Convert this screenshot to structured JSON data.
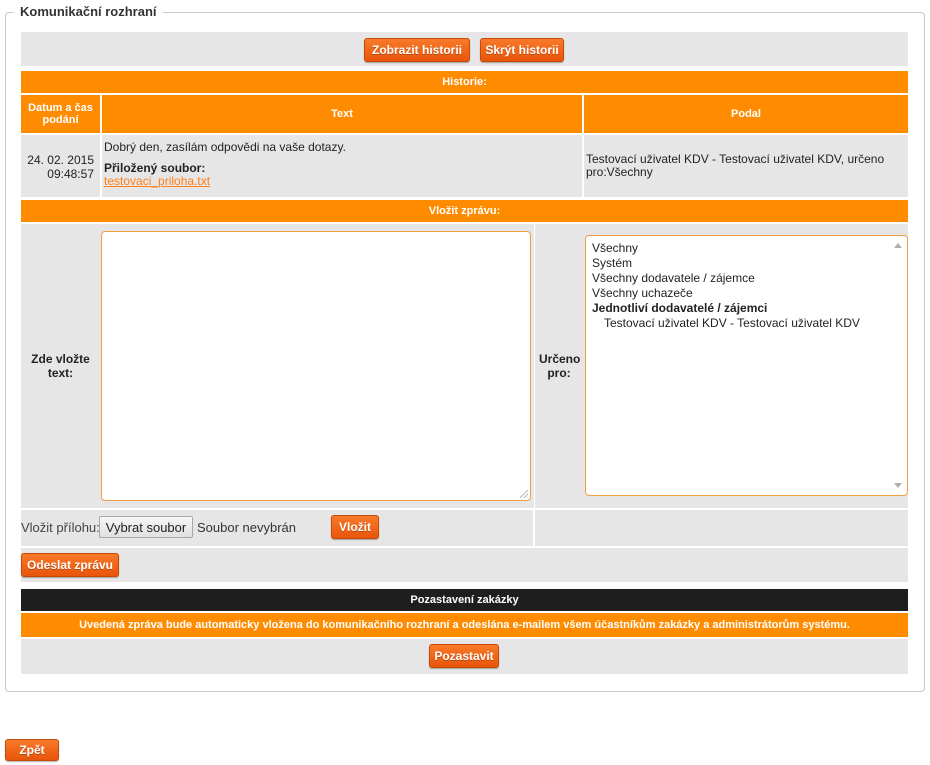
{
  "fieldset": {
    "legend": "Komunikační rozhraní"
  },
  "history_buttons": {
    "show": "Zobrazit historii",
    "hide": "Skrýt historii"
  },
  "history": {
    "title": "Historie:",
    "columns": {
      "date": "Datum a čas podání",
      "text": "Text",
      "submitted_by": "Podal"
    },
    "rows": [
      {
        "date": "24. 02. 2015",
        "time": "09:48:57",
        "text": "Dobrý den, zasílám odpovědi na vaše dotazy.",
        "attachment_label": "Přiložený soubor:",
        "attachment_link": "testovaci_priloha.txt",
        "submitted_by": "Testovací uživatel KDV - Testovací uživatel KDV, určeno pro:Všechny"
      }
    ]
  },
  "compose": {
    "title": "Vložit zprávu:",
    "text_label": "Zde vložte text:",
    "recipient_label": "Určeno pro:",
    "recipients": [
      {
        "label": "Všechny",
        "bold": false,
        "indent": false
      },
      {
        "label": "Systém",
        "bold": false,
        "indent": false
      },
      {
        "label": "Všechny dodavatele / zájemce",
        "bold": false,
        "indent": false
      },
      {
        "label": "Všechny uchazeče",
        "bold": false,
        "indent": false
      },
      {
        "label": "Jednotliví dodavatelé / zájemci",
        "bold": true,
        "indent": false
      },
      {
        "label": "Testovací uživatel KDV - Testovací uživatel KDV",
        "bold": false,
        "indent": true
      }
    ],
    "attach_label": "Vložit přílohu:",
    "choose_file": "Vybrat soubor",
    "no_file": "Soubor nevybrán",
    "insert_button": "Vložit",
    "send_button": "Odeslat zprávu"
  },
  "suspend": {
    "title": "Pozastavení zakázky",
    "notice": "Uvedená zpráva bude automaticky vložena do komunikačního rozhraní a odeslána e-mailem všem účastníkům zakázky a administrátorům systému.",
    "button": "Pozastavit"
  },
  "back_button": "Zpět",
  "colors": {
    "accent": "#ff8c00",
    "button": "#ee5f10",
    "dark_bar": "#1e1e1e",
    "panel": "#e6e6e6"
  }
}
